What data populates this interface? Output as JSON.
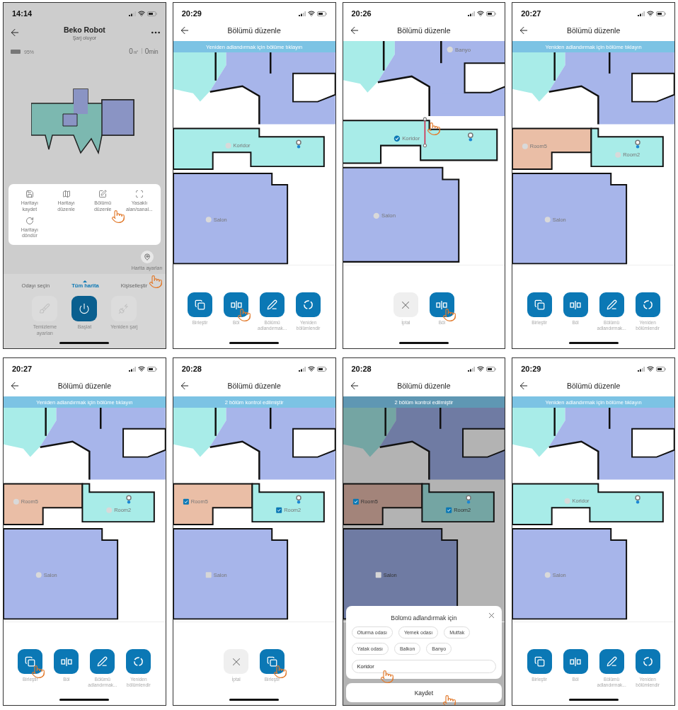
{
  "panels": [
    {
      "kind": "home",
      "time": "14:14",
      "title": "Beko Robot",
      "subtitle": "Şarj oluyor",
      "battery": "95%",
      "area_value": "0",
      "area_unit": "㎡",
      "duration_value": "0",
      "duration_unit": "min",
      "menu": [
        {
          "label": "Haritayı kaydet",
          "kind": "save",
          "tapped": false
        },
        {
          "label": "Haritayı düzenle",
          "kind": "map",
          "tapped": false
        },
        {
          "label": "Bölümü düzenle",
          "kind": "edit",
          "tapped": true
        },
        {
          "label": "Yasaklı alan/sanal...",
          "kind": "zone",
          "tapped": false
        },
        {
          "label": "Haritayı döndür",
          "kind": "rotate",
          "tapped": false
        }
      ],
      "map_settings": {
        "label": "Harita ayarları",
        "tapped": true
      },
      "tabs": [
        {
          "label": "Odayı seçin",
          "selected": false
        },
        {
          "label": "Tüm harita",
          "selected": true
        },
        {
          "label": "Kişiselleştir",
          "selected": false
        }
      ],
      "controls": [
        {
          "label": "Temizleme ayarları",
          "kind": "brush",
          "disabled": true
        },
        {
          "label": "Başlat",
          "kind": "power",
          "disabled": false
        },
        {
          "label": "Yeniden şarj",
          "kind": "charge",
          "disabled": true
        }
      ]
    },
    {
      "kind": "edit",
      "time": "20:29",
      "title": "Bölümü düzenle",
      "banner": "Yeniden adlandırmak için bölüme tıklayın",
      "rooms": [
        {
          "label": "Koridor",
          "kind": "corridor",
          "color": "#a8ece8"
        },
        {
          "label": "Salon",
          "kind": "hall",
          "color": "#a7b5ea"
        }
      ],
      "actions": [
        {
          "label": "Birleştir",
          "kind": "merge",
          "tapped": false
        },
        {
          "label": "Böl",
          "kind": "split",
          "tapped": true
        },
        {
          "label": "Bölümü adlandırmak...",
          "kind": "rename",
          "tapped": false
        },
        {
          "label": "Yeniden bölümlendir",
          "kind": "resegment",
          "tapped": false
        }
      ]
    },
    {
      "kind": "edit",
      "time": "20:26",
      "title": "Bölümü düzenle",
      "split_line": true,
      "map_tapped": true,
      "rooms": [
        {
          "label": "Banyo",
          "kind": "upper",
          "color": "#a7b5ea"
        },
        {
          "label": "Koridor",
          "kind": "corridor",
          "color": "#a8ece8",
          "checked": true
        },
        {
          "label": "Salon",
          "kind": "hall",
          "color": "#a7b5ea",
          "checked": false
        }
      ],
      "actions": [
        {
          "label": "İptal",
          "kind": "cancel",
          "tapped": false
        },
        {
          "label": "Böl",
          "kind": "split",
          "tapped": true
        }
      ]
    },
    {
      "kind": "edit",
      "time": "20:27",
      "title": "Bölümü düzenle",
      "banner": "Yeniden adlandırmak için bölüme tıklayın",
      "rooms": [
        {
          "label": "Room5",
          "kind": "west",
          "color": "#eabea6"
        },
        {
          "label": "Room2",
          "kind": "east",
          "color": "#a8ece8"
        },
        {
          "label": "Salon",
          "kind": "hall",
          "color": "#a7b5ea"
        }
      ],
      "actions": [
        {
          "label": "Birleştir",
          "kind": "merge",
          "tapped": false
        },
        {
          "label": "Böl",
          "kind": "split",
          "tapped": false
        },
        {
          "label": "Bölümü adlandırmak...",
          "kind": "rename",
          "tapped": false
        },
        {
          "label": "Yeniden bölümlendir",
          "kind": "resegment",
          "tapped": false
        }
      ]
    },
    {
      "kind": "edit",
      "time": "20:27",
      "title": "Bölümü düzenle",
      "banner": "Yeniden adlandırmak için bölüme tıklayın",
      "rooms": [
        {
          "label": "Room5",
          "kind": "west",
          "color": "#eabea6"
        },
        {
          "label": "Room2",
          "kind": "east",
          "color": "#a8ece8"
        },
        {
          "label": "Salon",
          "kind": "hall",
          "color": "#a7b5ea"
        }
      ],
      "actions": [
        {
          "label": "Birleştir",
          "kind": "merge",
          "tapped": true
        },
        {
          "label": "Böl",
          "kind": "split",
          "tapped": false
        },
        {
          "label": "Bölümü adlandırmak...",
          "kind": "rename",
          "tapped": false
        },
        {
          "label": "Yeniden bölümlendir",
          "kind": "resegment",
          "tapped": false
        }
      ]
    },
    {
      "kind": "edit",
      "time": "20:28",
      "title": "Bölümü düzenle",
      "banner": "2 bölüm kontrol edilmiştir",
      "rooms": [
        {
          "label": "Room5",
          "kind": "west",
          "color": "#eabea6",
          "checked": true
        },
        {
          "label": "Room2",
          "kind": "east",
          "color": "#a8ece8",
          "checked": true
        },
        {
          "label": "Salon",
          "kind": "hall",
          "color": "#a7b5ea",
          "checked": false
        }
      ],
      "actions": [
        {
          "label": "İptal",
          "kind": "cancel",
          "tapped": false
        },
        {
          "label": "Birleştir",
          "kind": "merge",
          "tapped": true
        }
      ]
    },
    {
      "kind": "edit",
      "time": "20:28",
      "title": "Bölümü düzenle",
      "banner": "2 bölüm kontrol edilmiştir",
      "dimmed": true,
      "rooms": [
        {
          "label": "Room5",
          "kind": "west",
          "color": "#a3847a",
          "checked": true
        },
        {
          "label": "Room2",
          "kind": "east",
          "color": "#74a5a3",
          "checked": true
        },
        {
          "label": "Salon",
          "kind": "hall",
          "color": "#6f7ba3",
          "checked": false
        }
      ],
      "sheet": {
        "title": "Bölümü adlandırmak için",
        "chips": [
          {
            "label": "Oturma odası"
          },
          {
            "label": "Yemek odası"
          },
          {
            "label": "Mutfak"
          },
          {
            "label": "Yatak odası"
          },
          {
            "label": "Balkon"
          },
          {
            "label": "Banyo"
          }
        ],
        "input": {
          "value": "Koridor",
          "tapped": true
        },
        "save": {
          "label": "Kaydet",
          "tapped": true
        }
      }
    },
    {
      "kind": "edit",
      "time": "20:29",
      "title": "Bölümü düzenle",
      "banner": "Yeniden adlandırmak için bölüme tıklayın",
      "rooms": [
        {
          "label": "Koridor",
          "kind": "corridor",
          "color": "#a8ece8"
        },
        {
          "label": "Salon",
          "kind": "hall",
          "color": "#a7b5ea"
        }
      ],
      "actions": [
        {
          "label": "Birleştir",
          "kind": "merge",
          "tapped": false
        },
        {
          "label": "Böl",
          "kind": "split",
          "tapped": false
        },
        {
          "label": "Bölümü adlandırmak...",
          "kind": "rename",
          "tapped": false
        },
        {
          "label": "Yeniden bölümlendir",
          "kind": "resegment",
          "tapped": false
        }
      ]
    }
  ]
}
